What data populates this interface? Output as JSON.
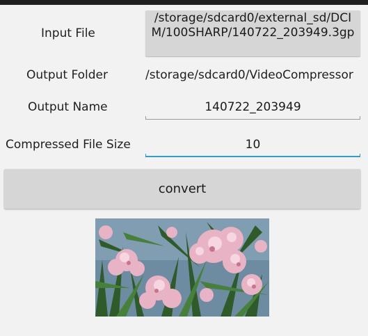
{
  "form": {
    "input_file_label": "Input File",
    "input_file_value": "/storage/sdcard0/external_sd/DCIM/100SHARP/140722_203949.3gp",
    "output_folder_label": "Output Folder",
    "output_folder_value": "/storage/sdcard0/VideoCompressor",
    "output_name_label": "Output Name",
    "output_name_value": "140722_203949",
    "compressed_size_label": "Compressed File Size",
    "compressed_size_value": "10"
  },
  "actions": {
    "convert_label": "convert"
  },
  "preview": {
    "subject": "pink-oleander-flowers"
  },
  "colors": {
    "focus_accent": "#2e9ed1",
    "button_bg": "#d6d6d6",
    "background": "#f2f2f2"
  }
}
